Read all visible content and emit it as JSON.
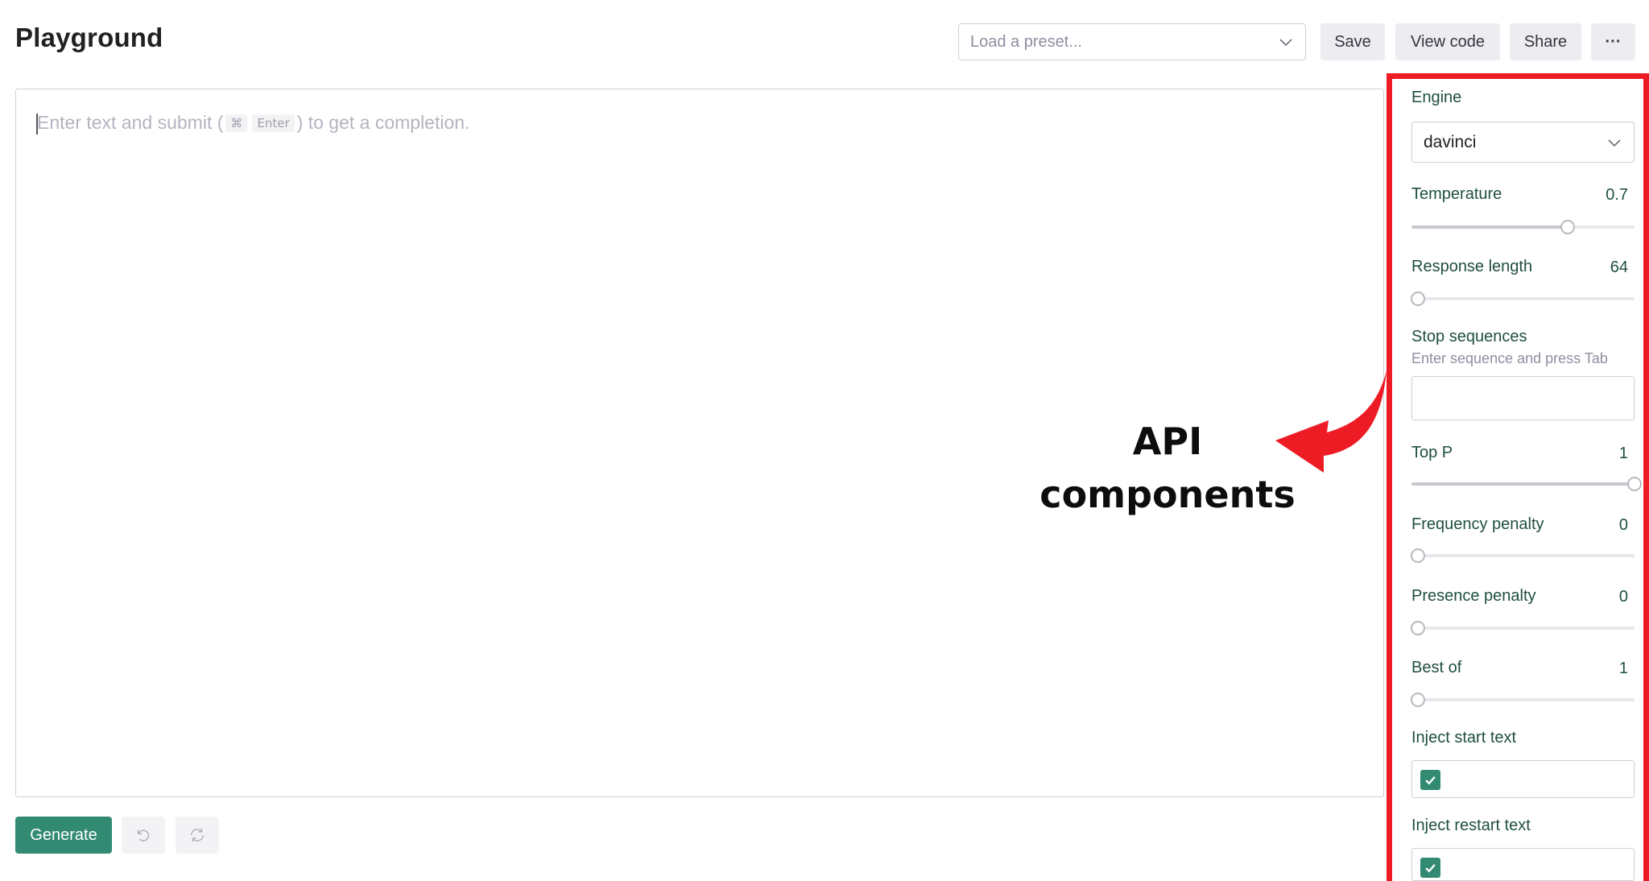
{
  "header": {
    "title": "Playground",
    "preset_placeholder": "Load a preset...",
    "save_label": "Save",
    "view_code_label": "View code",
    "share_label": "Share",
    "more_label": "···"
  },
  "editor": {
    "placeholder_before": "Enter text and submit (",
    "key_cmd": "⌘",
    "key_enter": "Enter",
    "placeholder_after": ") to get a completion."
  },
  "footer": {
    "generate_label": "Generate",
    "undo_icon": "undo-icon",
    "regenerate_icon": "regenerate-icon"
  },
  "settings": {
    "engine": {
      "label": "Engine",
      "value": "davinci"
    },
    "temperature": {
      "label": "Temperature",
      "value": "0.7",
      "fraction": 0.7
    },
    "response_length": {
      "label": "Response length",
      "value": "64",
      "fraction": 0.03
    },
    "stop_sequences": {
      "label": "Stop sequences",
      "hint": "Enter sequence and press Tab"
    },
    "top_p": {
      "label": "Top P",
      "value": "1",
      "fraction": 1.0
    },
    "frequency_penalty": {
      "label": "Frequency penalty",
      "value": "0",
      "fraction": 0.0
    },
    "presence_penalty": {
      "label": "Presence penalty",
      "value": "0",
      "fraction": 0.0
    },
    "best_of": {
      "label": "Best of",
      "value": "1",
      "fraction": 0.0
    },
    "inject_start_text": {
      "label": "Inject start text",
      "checked": true
    },
    "inject_restart_text": {
      "label": "Inject restart text",
      "checked": true
    }
  },
  "annotation": {
    "line1": "API",
    "line2": "components",
    "highlight_color": "#ed1c24"
  },
  "colors": {
    "accent": "#338a73",
    "label": "#1f4e42"
  }
}
